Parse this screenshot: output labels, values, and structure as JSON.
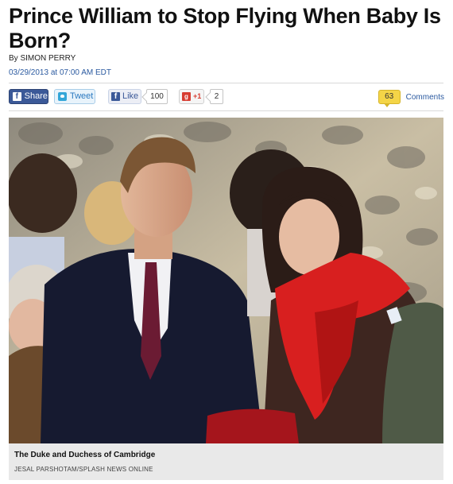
{
  "article": {
    "headline": "Prince William to Stop Flying When Baby Is Born?",
    "byline_prefix": "By",
    "author": "SIMON PERRY",
    "date": "03/29/2013 at 07:00 AM EDT"
  },
  "share_bar": {
    "facebook_share_label": "Share",
    "twitter_label": "Tweet",
    "facebook_like_label": "Like",
    "like_count": "100",
    "gplus_label": "+1",
    "gplus_count": "2",
    "comment_count": "63",
    "comments_label": "Comments"
  },
  "photo": {
    "caption": "The Duke and Duchess of Cambridge",
    "credit": "JESAL PARSHOTAM/SPLASH NEWS ONLINE"
  },
  "colors": {
    "facebook_blue": "#3b5998",
    "link_blue": "#2b5aa0",
    "comment_yellow": "#f4d547",
    "scarf_red": "#d81f1f"
  }
}
